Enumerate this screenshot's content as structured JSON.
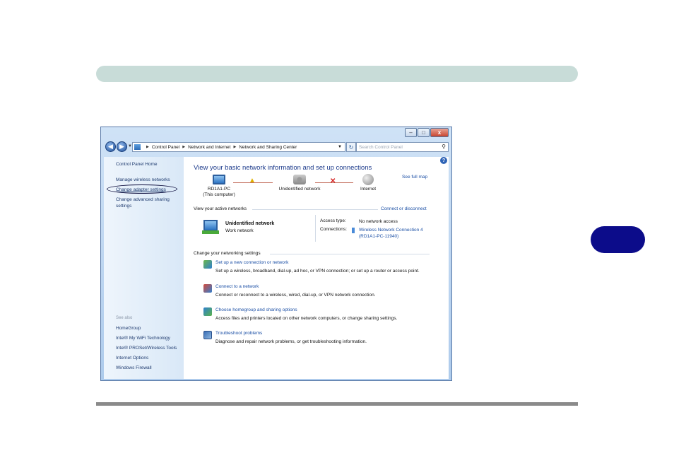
{
  "window": {
    "caption_buttons": {
      "minimize": "–",
      "maximize": "□",
      "close": "x"
    }
  },
  "navbar": {
    "back_glyph": "◀",
    "forward_glyph": "▶",
    "breadcrumbs": [
      "Control Panel",
      "Network and Internet",
      "Network and Sharing Center"
    ],
    "search_placeholder": "Search Control Panel"
  },
  "sidebar": {
    "home": "Control Panel Home",
    "links": [
      "Manage wireless networks",
      "Change adapter settings",
      "Change advanced sharing settings"
    ],
    "see_also_heading": "See also",
    "see_also": [
      "HomeGroup",
      "Intel® My WiFi Technology",
      "Intel® PROSet/Wireless Tools",
      "Internet Options",
      "Windows Firewall"
    ]
  },
  "main": {
    "title": "View your basic network information and set up connections",
    "see_full_map": "See full map",
    "map": {
      "computer_name": "RD1A1-PC",
      "computer_sub": "(This computer)",
      "network": "Unidentified network",
      "internet": "Internet"
    },
    "active_networks": {
      "heading": "View your active networks",
      "connect_link": "Connect or disconnect",
      "network_name": "Unidentified network",
      "network_type": "Work network",
      "access_type_label": "Access type:",
      "access_type_value": "No network access",
      "connections_label": "Connections:",
      "connection_value_1": "Wireless Network Connection 4",
      "connection_value_2": "(RD1A1-PC-11940)"
    },
    "settings": {
      "heading": "Change your networking settings",
      "tasks": [
        {
          "title": "Set up a new connection or network",
          "desc": "Set up a wireless, broadband, dial-up, ad hoc, or VPN connection; or set up a router or access point."
        },
        {
          "title": "Connect to a network",
          "desc": "Connect or reconnect to a wireless, wired, dial-up, or VPN network connection."
        },
        {
          "title": "Choose homegroup and sharing options",
          "desc": "Access files and printers located on other network computers, or change sharing settings."
        },
        {
          "title": "Troubleshoot problems",
          "desc": "Diagnose and repair network problems, or get troubleshooting information."
        }
      ]
    }
  },
  "colors": {
    "header_bar": "#c8dcd8",
    "chapter_tab": "#0c0c8a",
    "link": "#1b4fa5"
  }
}
